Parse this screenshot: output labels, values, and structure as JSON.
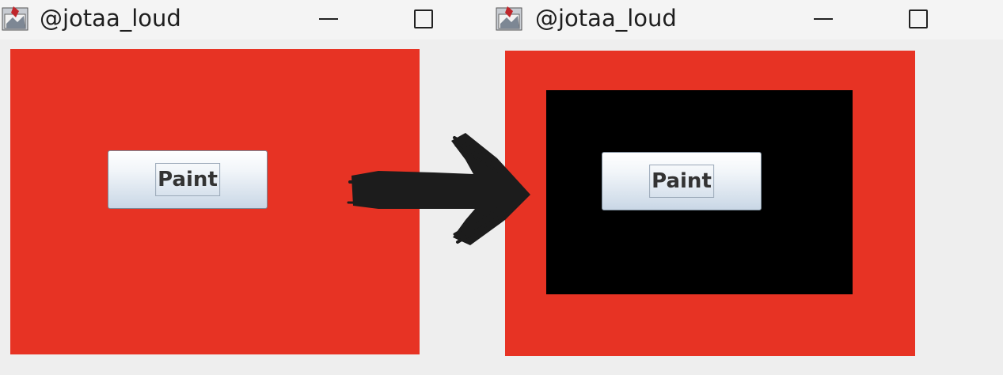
{
  "windows": [
    {
      "title": "@jotaa_loud",
      "button_label": "Paint",
      "show_black_rect": false
    },
    {
      "title": "@jotaa_loud",
      "button_label": "Paint",
      "show_black_rect": true
    }
  ],
  "colors": {
    "panel_fill": "#e73324",
    "painted_rect": "#000000",
    "arrow": "#1c1c1c"
  },
  "icons": {
    "window_icon": "java-app-icon",
    "minimize": "minimize-icon",
    "maximize": "maximize-icon",
    "transition": "brush-arrow-icon"
  }
}
